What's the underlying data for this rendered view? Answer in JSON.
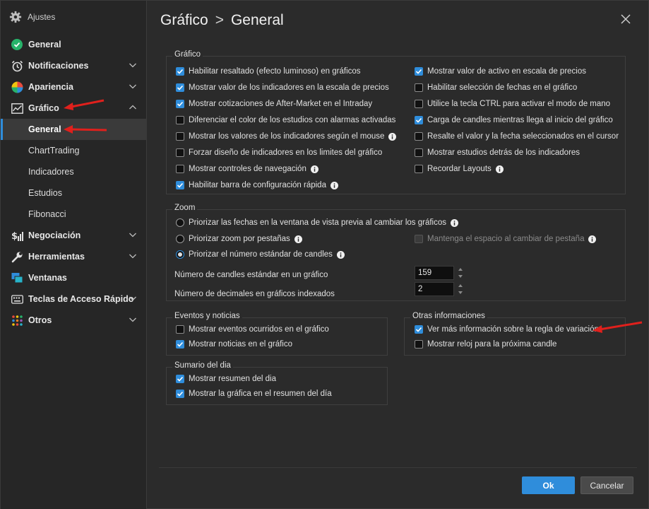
{
  "window": {
    "title": "Ajustes"
  },
  "sidebar": {
    "items": [
      {
        "label": "General",
        "icon": "check-circle-icon",
        "expandable": false
      },
      {
        "label": "Notificaciones",
        "icon": "alarm-clock-icon",
        "expandable": true
      },
      {
        "label": "Apariencia",
        "icon": "color-palette-icon",
        "expandable": true
      },
      {
        "label": "Gráfico",
        "icon": "chart-icon",
        "expandable": true,
        "expanded": true
      },
      {
        "label": "Negociación",
        "icon": "dollar-chart-icon",
        "expandable": true
      },
      {
        "label": "Herramientas",
        "icon": "wrench-icon",
        "expandable": true
      },
      {
        "label": "Ventanas",
        "icon": "windows-icon",
        "expandable": false
      },
      {
        "label": "Teclas de Acceso Rápido",
        "icon": "keyboard-icon",
        "expandable": true
      },
      {
        "label": "Otros",
        "icon": "grid-dots-icon",
        "expandable": true
      }
    ],
    "grafico_sub": [
      "General",
      "ChartTrading",
      "Indicadores",
      "Estudios",
      "Fibonacci"
    ]
  },
  "header": {
    "section": "Gráfico",
    "separator": ">",
    "page": "General"
  },
  "grafico": {
    "label": "Gráfico",
    "left": [
      {
        "label": "Habilitar resaltado (efecto luminoso) en gráficos",
        "checked": true,
        "info": false
      },
      {
        "label": "Mostrar valor de los indicadores en la escala de precios",
        "checked": true,
        "info": false
      },
      {
        "label": "Mostrar cotizaciones de After-Market en el Intraday",
        "checked": true,
        "info": false
      },
      {
        "label": "Diferenciar el color de los estudios con alarmas activadas",
        "checked": false,
        "info": false
      },
      {
        "label": "Mostrar los valores de los indicadores según el mouse",
        "checked": false,
        "info": true
      },
      {
        "label": "Forzar diseño de indicadores en los limites del gráfico",
        "checked": false,
        "info": false
      },
      {
        "label": "Mostrar controles de navegación",
        "checked": false,
        "info": true
      },
      {
        "label": "Habilitar barra de configuración rápida",
        "checked": true,
        "info": true
      }
    ],
    "right": [
      {
        "label": "Mostrar valor de activo en escala de precios",
        "checked": true,
        "info": false
      },
      {
        "label": "Habilitar selección de fechas en el gráfico",
        "checked": false,
        "info": false
      },
      {
        "label": "Utilice la tecla CTRL para activar el modo de mano",
        "checked": false,
        "info": false
      },
      {
        "label": "Carga de candles mientras llega al inicio del gráfico",
        "checked": true,
        "info": false
      },
      {
        "label": "Resalte el valor y la fecha seleccionados en el cursor",
        "checked": false,
        "info": false
      },
      {
        "label": "Mostrar estudios detrás de los indicadores",
        "checked": false,
        "info": false
      },
      {
        "label": "Recordar Layouts",
        "checked": false,
        "info": true
      }
    ]
  },
  "zoom": {
    "label": "Zoom",
    "radios": [
      {
        "label": "Priorizar las fechas en la ventana de vista previa al cambiar los gráficos",
        "selected": false,
        "info": true
      },
      {
        "label": "Priorizar zoom por pestañas",
        "selected": false,
        "info": true
      },
      {
        "label": "Priorizar el número estándar de candles",
        "selected": true,
        "info": true
      }
    ],
    "keep_space": {
      "label": "Mantenga el espacio al cambiar de pestaña",
      "checked": false,
      "disabled": true
    },
    "candles_label": "Número de candles estándar en un gráfico",
    "candles_value": "159",
    "decimals_label": "Número de decimales en gráficos indexados",
    "decimals_value": "2"
  },
  "eventos": {
    "label": "Eventos y noticias",
    "items": [
      {
        "label": "Mostrar eventos ocurridos en el gráfico",
        "checked": false
      },
      {
        "label": "Mostrar noticias en el gráfico",
        "checked": true
      }
    ]
  },
  "otras": {
    "label": "Otras informaciones",
    "items": [
      {
        "label": "Ver más información sobre la regla de variación",
        "checked": true
      },
      {
        "label": "Mostrar reloj para la próxima candle",
        "checked": false
      }
    ]
  },
  "sumario": {
    "label": "Sumario del dia",
    "items": [
      {
        "label": "Mostrar resumen del dia",
        "checked": true
      },
      {
        "label": "Mostrar la gráfica en el resumen del día",
        "checked": true
      }
    ]
  },
  "footer": {
    "ok_label": "Ok",
    "cancel_label": "Cancelar"
  },
  "colors": {
    "accent": "#2f8ddb",
    "annotation_arrow": "#e0201c",
    "background": "#2b2b2b"
  }
}
